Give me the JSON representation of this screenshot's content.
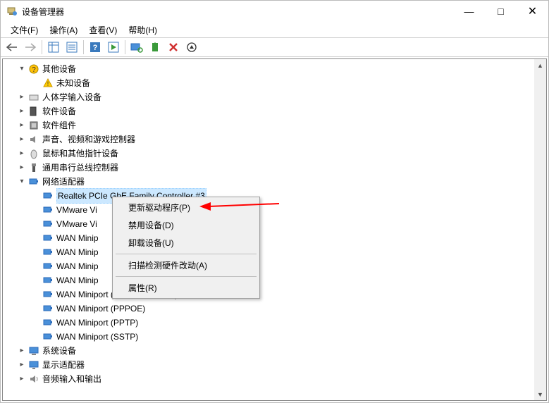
{
  "window": {
    "title": "设备管理器",
    "controls": {
      "min": "—",
      "max": "□",
      "close": "✕"
    }
  },
  "menu": {
    "file": "文件(F)",
    "action": "操作(A)",
    "view": "查看(V)",
    "help": "帮助(H)"
  },
  "tree": {
    "other_devices": "其他设备",
    "unknown_device": "未知设备",
    "hid": "人体学输入设备",
    "software_devices": "软件设备",
    "software_components": "软件组件",
    "sound": "声音、视频和游戏控制器",
    "mouse": "鼠标和其他指针设备",
    "usb": "通用串行总线控制器",
    "net_adapters": "网络适配器",
    "realtek": "Realtek PCIe GbE Family Controller #3",
    "vmware1": "VMware Vi",
    "vmware2": "VMware Vi",
    "wanmp_short": "WAN Minip",
    "wan_nm": "WAN Miniport (Network Monitor)",
    "wan_pppoe": "WAN Miniport (PPPOE)",
    "wan_pptp": "WAN Miniport (PPTP)",
    "wan_sstp": "WAN Miniport (SSTP)",
    "system_devices": "系统设备",
    "display_adapters": "显示适配器",
    "audio_io": "音频输入和输出"
  },
  "context_menu": {
    "update_driver": "更新驱动程序(P)",
    "disable": "禁用设备(D)",
    "uninstall": "卸载设备(U)",
    "scan": "扫描检测硬件改动(A)",
    "properties": "属性(R)"
  }
}
